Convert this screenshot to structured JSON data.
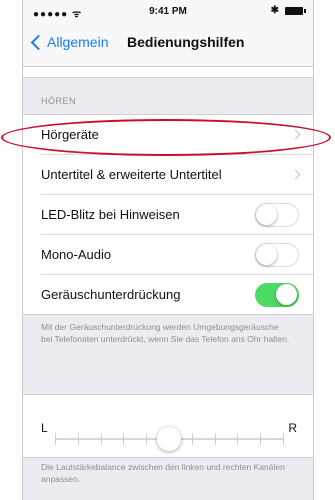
{
  "status_bar": {
    "carrier": "●●●●● ᯤ",
    "time": "9:41 PM",
    "bluetooth": "✱"
  },
  "nav": {
    "back_label": "Allgemein",
    "title": "Bedienungshilfen"
  },
  "section_header": "HÖREN",
  "rows": [
    {
      "label": "Hörgeräte",
      "accessory": "chevron"
    },
    {
      "label": "Untertitel & erweiterte Untertitel",
      "accessory": "chevron"
    },
    {
      "label": "LED-Blitz bei Hinweisen",
      "accessory": "toggle",
      "on": false
    },
    {
      "label": "Mono-Audio",
      "accessory": "toggle",
      "on": false
    },
    {
      "label": "Geräuschunterdrückung",
      "accessory": "toggle",
      "on": true
    }
  ],
  "noise_footer": "Mit der Geräuschunterdrückung werden Umgebungsgeräusche bei Telefonaten unterdrückt, wenn Sie das Telefon ans Ohr halten.",
  "balance": {
    "left_label": "L",
    "right_label": "R",
    "value": 0.5
  },
  "balance_footer": "Die Lautstärkebalance zwischen den linken und rechten Kanälen anpassen.",
  "colors": {
    "accent": "#1a7cf0",
    "toggle_on": "#4cd964",
    "annotation": "#c8102e"
  }
}
